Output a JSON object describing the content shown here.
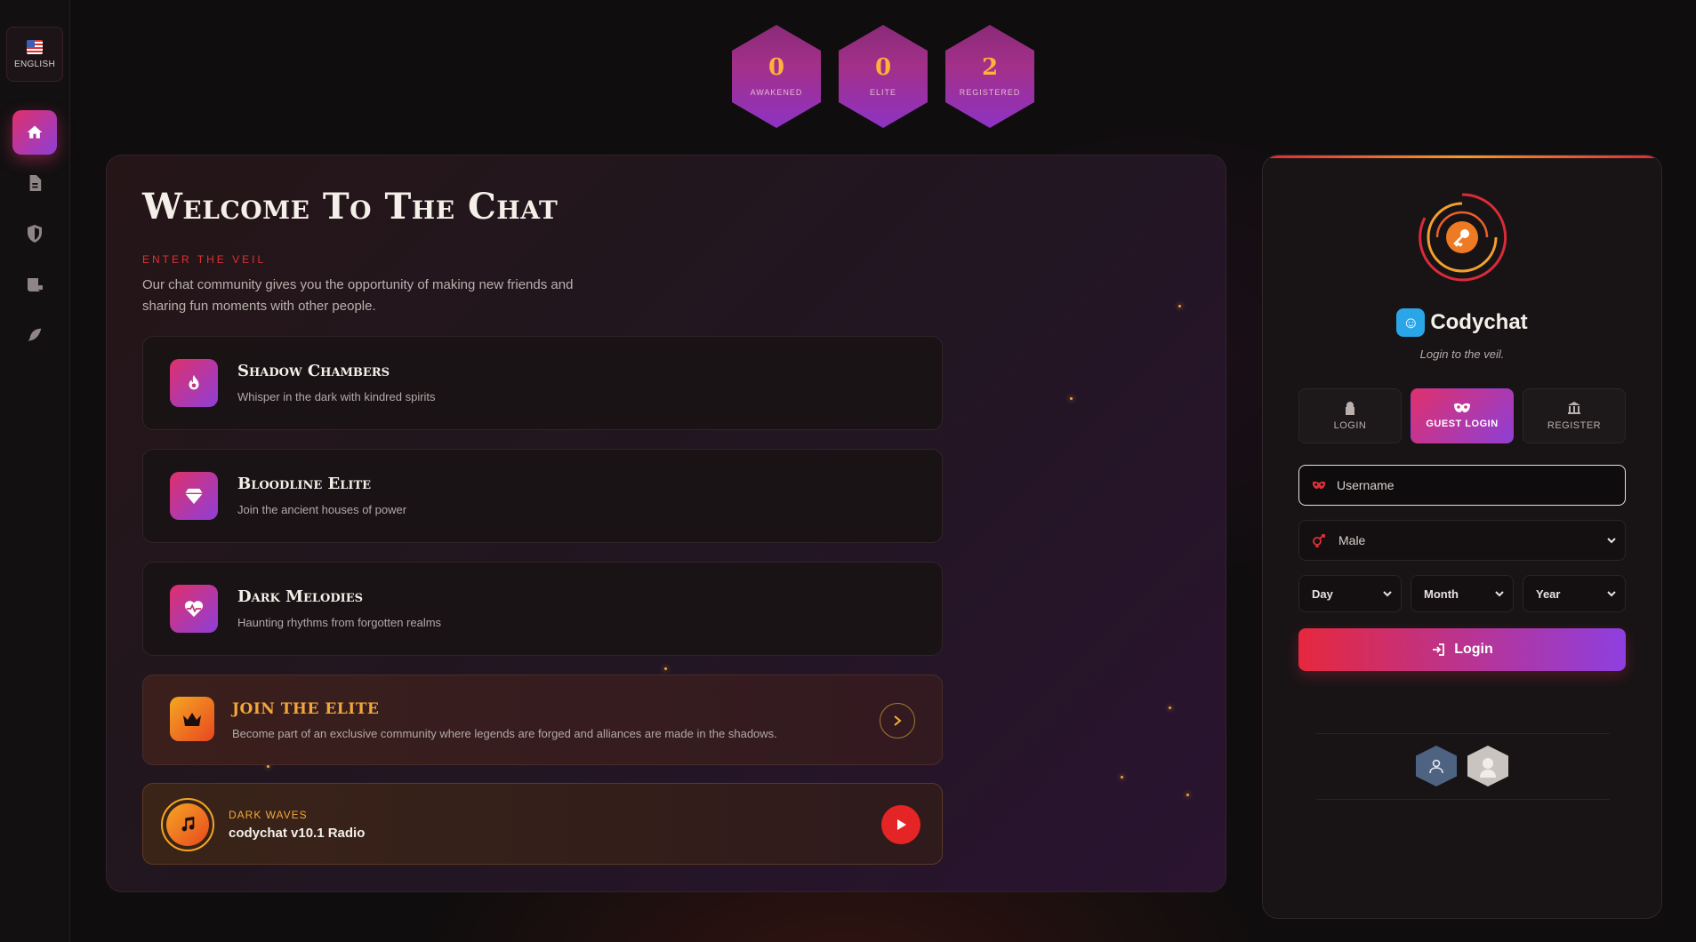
{
  "sidebar": {
    "language": "ENGLISH",
    "nav": [
      "home-icon",
      "document-icon",
      "shield-icon",
      "scroll-icon",
      "feather-icon"
    ]
  },
  "stats": [
    {
      "value": "0",
      "label": "AWAKENED"
    },
    {
      "value": "0",
      "label": "ELITE"
    },
    {
      "value": "2",
      "label": "REGISTERED"
    }
  ],
  "welcome": {
    "title": "Welcome To The Chat",
    "subtitle": "ENTER THE VEIL",
    "intro": "Our chat community gives you the opportunity of making new friends and sharing fun moments with other people."
  },
  "features": [
    {
      "title": "Shadow Chambers",
      "desc": "Whisper in the dark with kindred spirits",
      "icon": "fire-icon"
    },
    {
      "title": "Bloodline Elite",
      "desc": "Join the ancient houses of power",
      "icon": "diamond-icon"
    },
    {
      "title": "Dark Melodies",
      "desc": "Haunting rhythms from forgotten realms",
      "icon": "heartbeat-icon"
    }
  ],
  "elite": {
    "title": "JOIN THE ELITE",
    "desc": "Become part of an exclusive community where legends are forged and alliances are made in the shadows."
  },
  "radio": {
    "label": "DARK WAVES",
    "name": "codychat v10.1 Radio"
  },
  "login": {
    "brand": "Codychat",
    "tagline": "Login to the veil.",
    "tabs": [
      "LOGIN",
      "GUEST LOGIN",
      "REGISTER"
    ],
    "active_tab": "GUEST LOGIN",
    "username_placeholder": "Username",
    "gender": "Male",
    "day": "Day",
    "month": "Month",
    "year": "Year",
    "submit": "Login"
  },
  "colors": {
    "accent_gradient_start": "#e0306b",
    "accent_gradient_end": "#8d3fd8",
    "gold": "#f2a73a",
    "red": "#e03232"
  }
}
